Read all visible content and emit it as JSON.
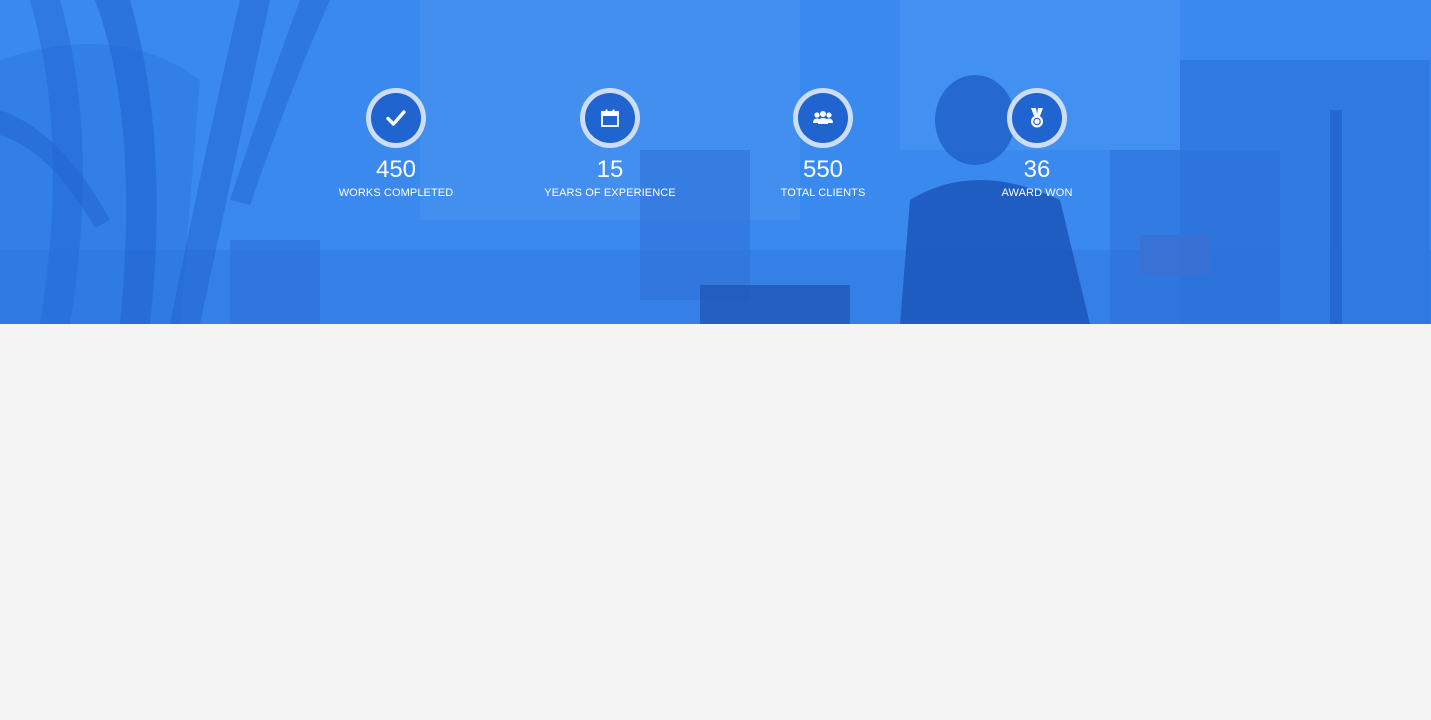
{
  "stats": [
    {
      "number": "450",
      "label": "WORKS COMPLETED",
      "icon": "check-icon"
    },
    {
      "number": "15",
      "label": "YEARS OF EXPERIENCE",
      "icon": "calendar-icon"
    },
    {
      "number": "550",
      "label": "TOTAL CLIENTS",
      "icon": "users-icon"
    },
    {
      "number": "36",
      "label": "AWARD WON",
      "icon": "medal-icon"
    }
  ],
  "colors": {
    "overlay_blue": "#3b8cf0",
    "circle_fill": "#1f64cf",
    "page_background": "#f4f4f4"
  }
}
